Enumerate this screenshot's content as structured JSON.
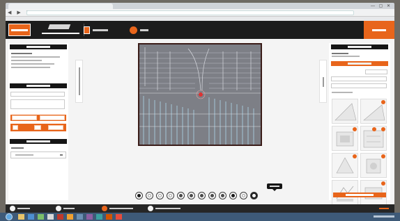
{
  "browser": {
    "tab_count": 1
  },
  "header": {
    "buttons": [
      {
        "name": "project-button",
        "icon": "folder-icon"
      },
      {
        "name": "help-button",
        "icon": "help-icon"
      },
      {
        "name": "order-button",
        "icon": "cart-icon"
      }
    ],
    "accent_color": "#e8651b"
  },
  "left_panel": {
    "sections": [
      {
        "name": "project-details"
      },
      {
        "name": "configuration"
      },
      {
        "name": "tool-selection"
      }
    ]
  },
  "right_panel": {
    "thumbnail_count": 8,
    "badge_color": "#e8651b"
  },
  "toolbar": {
    "tools": [
      {
        "name": "tool-1",
        "dot": "#1a1a1a"
      },
      {
        "name": "tool-2",
        "dot": "#ffffff"
      },
      {
        "name": "tool-3",
        "dot": "#ffffff"
      },
      {
        "name": "tool-4",
        "dot": "#ffffff"
      },
      {
        "name": "tool-5",
        "dot": "#4a4a4a"
      },
      {
        "name": "tool-6",
        "dot": "#4a4a4a"
      },
      {
        "name": "tool-7",
        "dot": "#4a4a4a"
      },
      {
        "name": "tool-8",
        "dot": "#4a4a4a"
      },
      {
        "name": "tool-9",
        "dot": "#4a4a4a"
      },
      {
        "name": "tool-10",
        "dot": "#1a1a1a"
      },
      {
        "name": "tool-11",
        "dot": "#ffffff"
      },
      {
        "name": "tool-12",
        "dot": "#1a1a1a"
      }
    ],
    "active_tool": 12
  },
  "steps": {
    "count": 4,
    "active_step": 3
  }
}
